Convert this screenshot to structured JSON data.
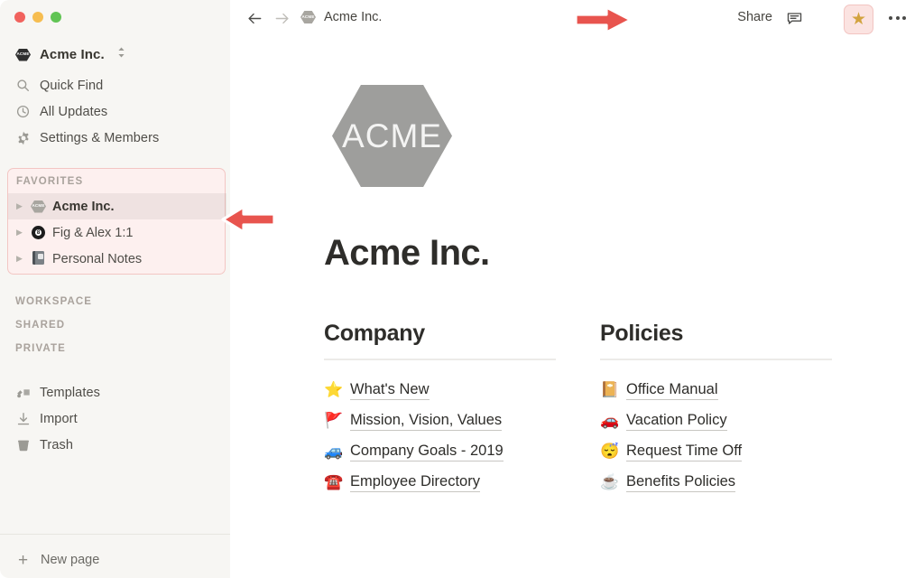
{
  "window": {
    "traffic_lights": [
      "close",
      "minimize",
      "zoom"
    ]
  },
  "sidebar": {
    "workspace": {
      "name": "Acme Inc.",
      "icon": "acme-hexagon-icon",
      "switcher_icon": "chevron-up-down-icon"
    },
    "nav_items": [
      {
        "label": "Quick Find",
        "icon": "search-icon"
      },
      {
        "label": "All Updates",
        "icon": "clock-icon"
      },
      {
        "label": "Settings & Members",
        "icon": "gear-icon"
      }
    ],
    "favorites": {
      "header": "FAVORITES",
      "highlighted": true,
      "items": [
        {
          "label": "Acme Inc.",
          "icon": "acme-hexagon-icon",
          "selected": true,
          "toggle": "triangle-right-icon"
        },
        {
          "label": "Fig & Alex 1:1",
          "icon": "eight-ball-icon",
          "selected": false,
          "toggle": "triangle-right-icon"
        },
        {
          "label": "Personal Notes",
          "icon": "notebook-icon",
          "selected": false,
          "toggle": "triangle-right-icon"
        }
      ]
    },
    "groups": [
      {
        "label": "WORKSPACE"
      },
      {
        "label": "SHARED"
      },
      {
        "label": "PRIVATE"
      }
    ],
    "bottom_items": [
      {
        "label": "Templates",
        "icon": "templates-icon"
      },
      {
        "label": "Import",
        "icon": "download-icon"
      },
      {
        "label": "Trash",
        "icon": "trash-icon"
      }
    ],
    "new_page": {
      "label": "New page",
      "icon": "plus-icon"
    }
  },
  "topbar": {
    "back_icon": "arrow-left-icon",
    "forward_icon": "arrow-right-icon",
    "breadcrumb": {
      "icon": "acme-hexagon-icon",
      "label": "Acme Inc."
    },
    "share_label": "Share",
    "comment_icon": "speech-bubble-icon",
    "star_icon": "star-icon",
    "star_highlighted": true,
    "more_icon": "ellipsis-icon"
  },
  "page": {
    "logo": {
      "text": "ACME",
      "shape": "hexagon",
      "color": "#9E9E9C"
    },
    "title": "Acme Inc.",
    "columns": [
      {
        "heading": "Company",
        "links": [
          {
            "emoji": "⭐",
            "emoji_name": "star-emoji",
            "label": "What's New"
          },
          {
            "emoji": "🚩",
            "emoji_name": "triangular-flag-emoji",
            "label": "Mission, Vision, Values"
          },
          {
            "emoji": "🚙",
            "emoji_name": "car-emoji",
            "label": "Company Goals - 2019"
          },
          {
            "emoji": "☎️",
            "emoji_name": "telephone-emoji",
            "label": "Employee Directory"
          }
        ]
      },
      {
        "heading": "Policies",
        "links": [
          {
            "emoji": "📔",
            "emoji_name": "notebook-emoji",
            "label": "Office Manual"
          },
          {
            "emoji": "🚗",
            "emoji_name": "red-car-emoji",
            "label": "Vacation Policy"
          },
          {
            "emoji": "😴",
            "emoji_name": "sleeping-face-emoji",
            "label": "Request Time Off"
          },
          {
            "emoji": "☕",
            "emoji_name": "coffee-emoji",
            "label": "Benefits Policies"
          }
        ]
      }
    ]
  },
  "annotations": {
    "arrow_to_star": {
      "direction": "right",
      "color": "#E8544E"
    },
    "arrow_to_favorites": {
      "direction": "left",
      "color": "#E8544E"
    },
    "highlight_color": "#F3C6C3"
  }
}
